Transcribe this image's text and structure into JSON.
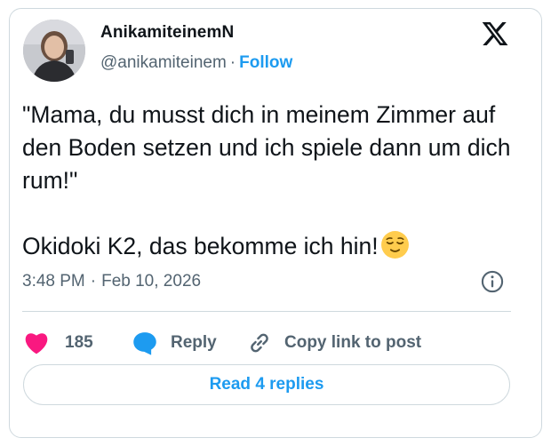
{
  "author": {
    "display_name": "AnikamiteinemN",
    "handle": "@anikamiteinem",
    "separator": "·",
    "follow_label": "Follow"
  },
  "tweet": {
    "text": "\"Mama, du musst dich in meinem Zimmer auf den Boden setzen und ich spiele dann um dich rum!\"\n\nOkidoki K2, das bekomme ich hin!",
    "emoji": "relieved-face"
  },
  "meta": {
    "time": "3:48 PM",
    "separator": "·",
    "date": "Feb 10, 2026"
  },
  "actions": {
    "likes_count": "185",
    "reply_label": "Reply",
    "copy_link_label": "Copy link to post"
  },
  "read_replies_label": "Read 4 replies",
  "icons": {
    "brand": "x-logo-icon",
    "info": "info-icon",
    "like": "heart-icon",
    "reply": "speech-bubble-icon",
    "copy": "link-icon"
  },
  "colors": {
    "accent": "#1d9bf0",
    "like": "#f91880",
    "muted": "#536471",
    "text": "#0f1419",
    "border": "#cfd9de"
  }
}
